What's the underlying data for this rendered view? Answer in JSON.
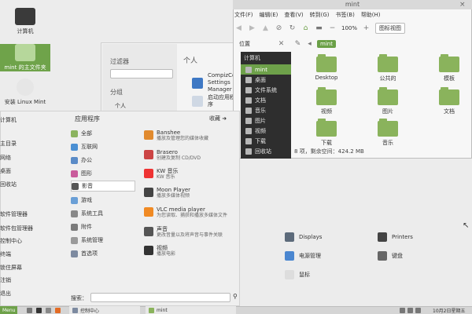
{
  "desktop": {
    "icons": [
      {
        "label": "计算机"
      },
      {
        "label": "mint 的主文件夹"
      },
      {
        "label": "安装 Linux Mint"
      }
    ]
  },
  "control_center": {
    "filter_label": "过滤器",
    "groups_label": "分组",
    "personal_group": "个人",
    "section_title": "个人",
    "items": [
      {
        "label": "CompizConfig Settings Manager"
      },
      {
        "label": "启动应用程序"
      }
    ]
  },
  "file_manager": {
    "title": "mint",
    "menu": [
      "文件(F)",
      "编辑(E)",
      "查看(V)",
      "转到(G)",
      "书签(B)",
      "帮助(H)"
    ],
    "toolbar": {
      "zoom": "100%",
      "view_mode": "图标视图"
    },
    "location_label": "位置",
    "crumb": "mint",
    "side_header": "计算机",
    "side_items": [
      "mint",
      "桌面",
      "文件系统",
      "文档",
      "音乐",
      "图片",
      "视频",
      "下载",
      "回收站"
    ],
    "folders": [
      "Desktop",
      "公共的",
      "模板",
      "视频",
      "图片",
      "文档",
      "下载",
      "音乐"
    ],
    "status": "8 项，剩余空间：424.2 MB"
  },
  "menu": {
    "left_items": [
      "计算机",
      "主目录",
      "网络",
      "桌面",
      "回收站",
      "软件管理器",
      "软件包管理器",
      "控制中心",
      "终端",
      "锁住屏幕",
      "注销",
      "退出"
    ],
    "apps_header": "应用程序",
    "favorites": "收藏",
    "categories": [
      "全部",
      "互联网",
      "办公",
      "图形",
      "影音",
      "游戏",
      "系统工具",
      "附件",
      "系统管理",
      "首选项"
    ],
    "apps": [
      {
        "name": "Banshee",
        "desc": "播放及管理您的媒体收藏"
      },
      {
        "name": "Brasero",
        "desc": "创建及复制 CD/DVD"
      },
      {
        "name": "KW 音乐",
        "desc": "KW 音乐"
      },
      {
        "name": "Moon Player",
        "desc": "播放多媒体视频"
      },
      {
        "name": "VLC media player",
        "desc": "为您读取、捕获和播放多媒体文件"
      },
      {
        "name": "声音",
        "desc": "更改音量以及将声音与事件关联"
      },
      {
        "name": "视频",
        "desc": "播放电影"
      }
    ],
    "search_label": "搜索："
  },
  "prefs": [
    {
      "label": "Displays"
    },
    {
      "label": "Printers"
    },
    {
      "label": "电源管理"
    },
    {
      "label": "键盘"
    },
    {
      "label": "鼠标"
    }
  ],
  "taskbar": {
    "menu_label": "Menu",
    "tasks": [
      "控制中心",
      "mint"
    ],
    "clock": "10月2日星期五"
  },
  "colors": {
    "accent": "#6ea14a",
    "panel_dark": "#2e2e2e"
  }
}
